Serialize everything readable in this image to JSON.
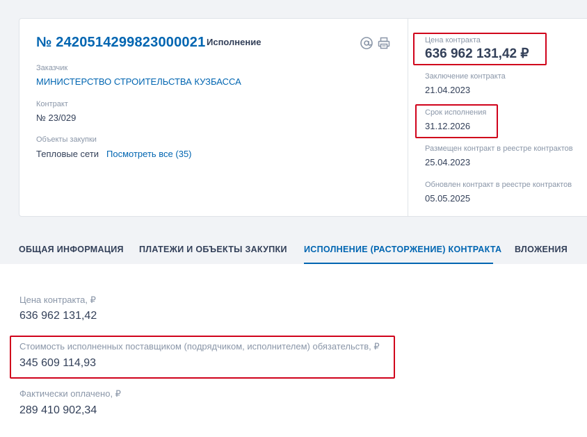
{
  "header": {
    "reg_number": "№ 2420514299823000021",
    "status": "Исполнение"
  },
  "icons": {
    "email": "at-sign-icon",
    "print": "printer-icon"
  },
  "left": {
    "customer_label": "Заказчик",
    "customer_value": "МИНИСТЕРСТВО СТРОИТЕЛЬСТВА КУЗБАССА",
    "contract_label": "Контракт",
    "contract_value": "№ 23/029",
    "objects_label": "Объекты закупки",
    "objects_value": "Тепловые сети",
    "objects_link": "Посмотреть все (35)"
  },
  "right": {
    "price_label": "Цена контракта",
    "price_value": "636 962 131,42 ₽",
    "signed_label": "Заключение контракта",
    "signed_value": "21.04.2023",
    "deadline_label": "Срок исполнения",
    "deadline_value": "31.12.2026",
    "placed_label": "Размещен контракт в реестре контрактов",
    "placed_value": "25.04.2023",
    "updated_label": "Обновлен контракт в реестре контрактов",
    "updated_value": "05.05.2025"
  },
  "tabs": [
    {
      "label": "ОБЩАЯ ИНФОРМАЦИЯ"
    },
    {
      "label": "ПЛАТЕЖИ И ОБЪЕКТЫ ЗАКУПКИ"
    },
    {
      "label": "ИСПОЛНЕНИЕ (РАСТОРЖЕНИЕ) КОНТРАКТА"
    },
    {
      "label": "ВЛОЖЕНИЯ"
    }
  ],
  "body": {
    "price_label": "Цена контракта, ₽",
    "price_value": "636 962 131,42",
    "executed_label": "Стоимость исполненных поставщиком (подрядчиком, исполнителем) обязательств, ₽",
    "executed_value": "345 609 114,93",
    "paid_label": "Фактически оплачено, ₽",
    "paid_value": "289 410 902,34"
  },
  "colors": {
    "accent": "#0065b1",
    "text": "#334059",
    "muted": "#8a96a8",
    "highlight": "#d0021b",
    "band": "#f1f3f6"
  }
}
